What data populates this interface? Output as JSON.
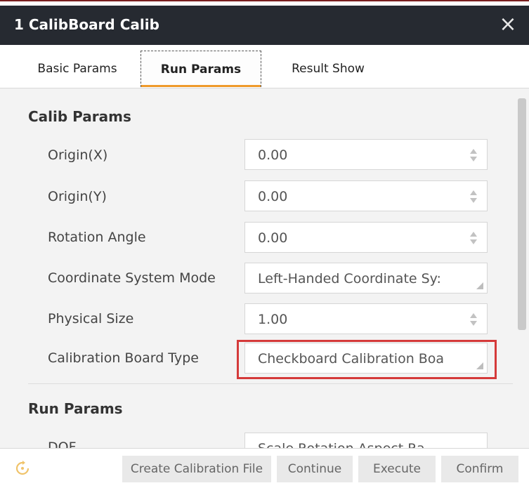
{
  "window": {
    "title": "1 CalibBoard Calib",
    "close_label": "×"
  },
  "tabs": [
    {
      "label": "Basic Params",
      "active": false
    },
    {
      "label": "Run Params",
      "active": true
    },
    {
      "label": "Result Show",
      "active": false
    }
  ],
  "calib_params": {
    "heading": "Calib Params",
    "origin_x": {
      "label": "Origin(X)",
      "value": "0.00"
    },
    "origin_y": {
      "label": "Origin(Y)",
      "value": "0.00"
    },
    "rotation_angle": {
      "label": "Rotation Angle",
      "value": "0.00"
    },
    "coordinate_system_mode": {
      "label": "Coordinate System Mode",
      "value": "Left-Handed Coordinate Sy:"
    },
    "physical_size": {
      "label": "Physical Size",
      "value": "1.00"
    },
    "calibration_board_type": {
      "label": "Calibration Board Type",
      "value": "Checkboard Calibration Boa"
    }
  },
  "run_params": {
    "heading": "Run Params",
    "dof": {
      "label": "DOF",
      "value": "Scale   Rotation   Aspect Ra"
    }
  },
  "footer": {
    "create_calibration_file": "Create Calibration File",
    "continue": "Continue",
    "execute": "Execute",
    "confirm": "Confirm"
  },
  "colors": {
    "titlebar": "#262a31",
    "active_tab_underline": "#ef9a2b",
    "highlight_border": "#d53a3a",
    "panel_background": "#f3f3f3"
  }
}
